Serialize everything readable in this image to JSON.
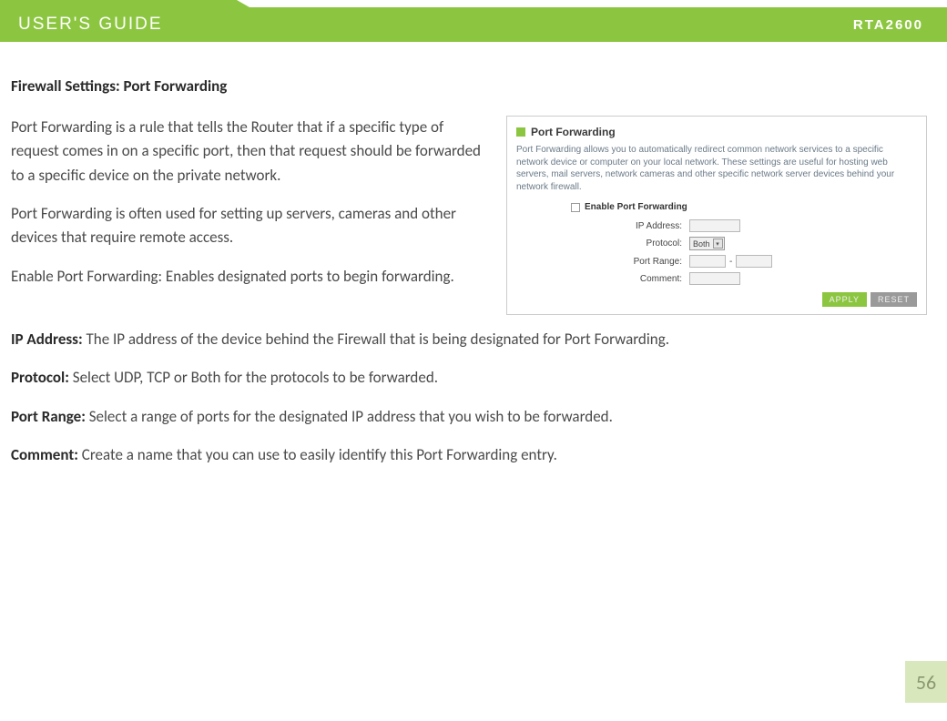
{
  "header": {
    "title": "USER'S GUIDE",
    "model": "RTA2600"
  },
  "section_title": "Firewall Settings: Port Forwarding",
  "paragraphs": {
    "p1": "Port Forwarding is a rule that tells the Router that if a specific type of request comes in on a specific port, then that request should be forwarded to a specific device on the private network.",
    "p2": "Port Forwarding is often used for setting up servers, cameras and other devices that require remote access.",
    "p3": "Enable Port Forwarding: Enables designated ports to begin forwarding.",
    "p4_label": "IP Address:",
    "p4_text": "  The IP address of the device behind the Firewall that is being designated for Port Forwarding.",
    "p5_label": "Protocol:",
    "p5_text": " Select UDP, TCP or Both for the protocols to be forwarded.",
    "p6_label": "Port Range:",
    "p6_text": " Select a range of ports for the designated IP address that you wish to be forwarded.",
    "p7_label": "Comment:",
    "p7_text": " Create a name that you can use to easily identify this Port Forwarding entry."
  },
  "figure": {
    "title": "Port Forwarding",
    "desc": "Port Forwarding allows you to automatically redirect common network services to a specific network device or computer on your local network. These settings are useful for hosting web servers, mail servers, network cameras and other specific network server devices behind your network firewall.",
    "enable_label": "Enable Port Forwarding",
    "labels": {
      "ip": "IP Address:",
      "protocol": "Protocol:",
      "port_range": "Port Range:",
      "comment": "Comment:"
    },
    "protocol_value": "Both",
    "buttons": {
      "apply": "APPLY",
      "reset": "RESET"
    }
  },
  "page_number": "56"
}
